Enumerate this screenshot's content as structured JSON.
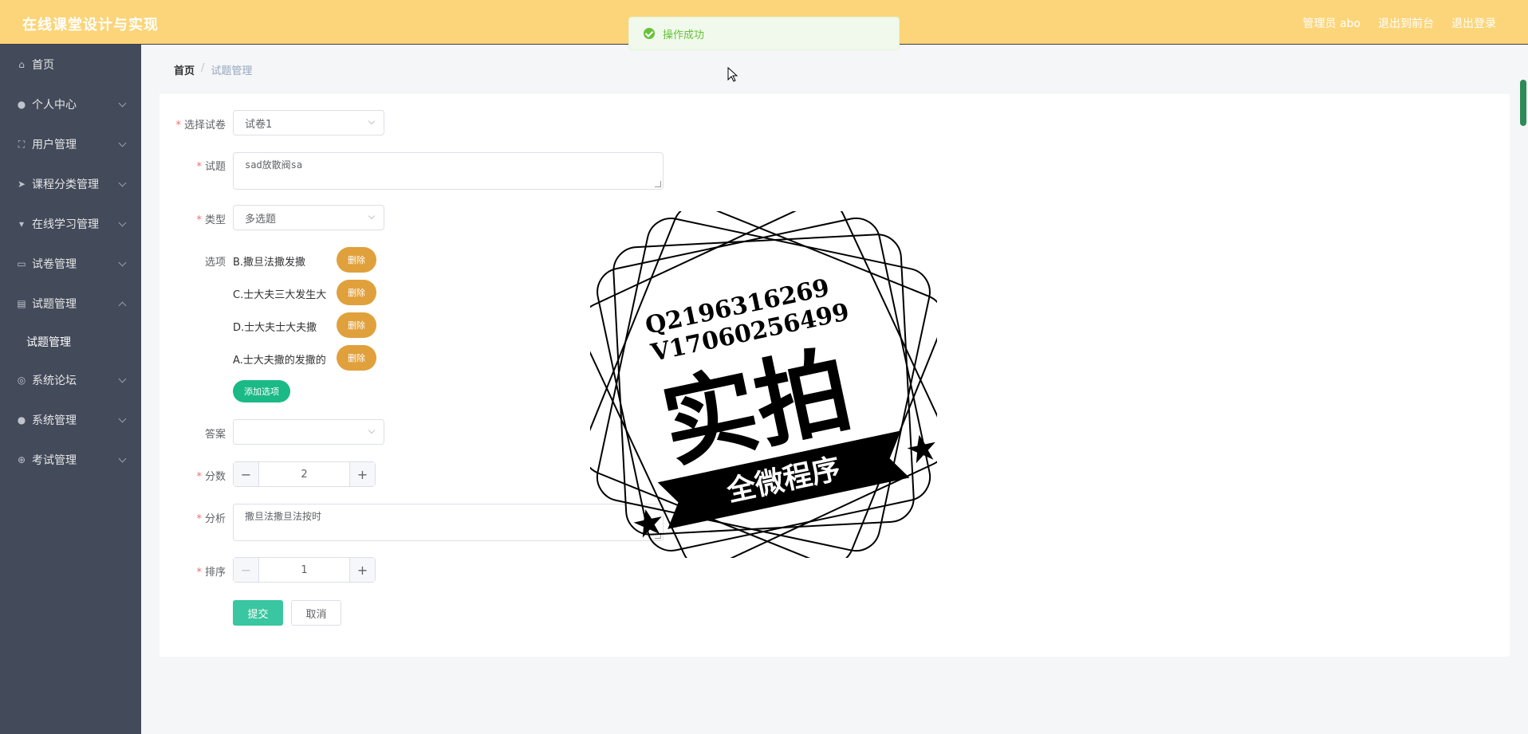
{
  "header": {
    "title": "在线课堂设计与实现",
    "admin": "管理员 abo",
    "to_front": "退出到前台",
    "logout": "退出登录"
  },
  "toast": {
    "message": "操作成功"
  },
  "sidebar": {
    "items": [
      {
        "label": "首页",
        "icon": "home-icon",
        "expandable": false
      },
      {
        "label": "个人中心",
        "icon": "user-icon",
        "expandable": true
      },
      {
        "label": "用户管理",
        "icon": "frame-icon",
        "expandable": true
      },
      {
        "label": "课程分类管理",
        "icon": "send-icon",
        "expandable": true
      },
      {
        "label": "在线学习管理",
        "icon": "pin-icon",
        "expandable": true
      },
      {
        "label": "试卷管理",
        "icon": "chat-icon",
        "expandable": true
      },
      {
        "label": "试题管理",
        "icon": "card-icon",
        "expandable": true,
        "expanded": true
      },
      {
        "label": "系统论坛",
        "icon": "compass-icon",
        "expandable": true
      },
      {
        "label": "系统管理",
        "icon": "user-icon",
        "expandable": true
      },
      {
        "label": "考试管理",
        "icon": "globe-icon",
        "expandable": true
      }
    ],
    "sub_item": "试题管理"
  },
  "breadcrumb": {
    "home": "首页",
    "separator": "/",
    "current": "试题管理"
  },
  "form": {
    "paper": {
      "label": "选择试卷",
      "value": "试卷1"
    },
    "question": {
      "label": "试题",
      "value": "sad放散阀sa"
    },
    "type": {
      "label": "类型",
      "value": "多选题"
    },
    "options": {
      "label": "选项",
      "items": [
        "B.撒旦法撒发撒",
        "C.士大夫三大发生大",
        "D.士大夫士大夫撒",
        "A.士大夫撒的发撒的"
      ],
      "delete_label": "删除",
      "add_label": "添加选项"
    },
    "answer": {
      "label": "答案",
      "value": ""
    },
    "score": {
      "label": "分数",
      "value": "2"
    },
    "analysis": {
      "label": "分析",
      "value": "撒旦法撒旦法按时"
    },
    "order": {
      "label": "排序",
      "value": "1"
    },
    "submit_label": "提交",
    "cancel_label": "取消"
  },
  "watermark": {
    "line1": "Q2196316269",
    "line2": "V17060256499",
    "main": "实拍",
    "banner": "全微程序"
  },
  "colors": {
    "header_bg": "#fcd57a",
    "sidebar_bg": "#434a5a",
    "delete_btn": "#e0a03c",
    "add_btn": "#1bb985",
    "submit_btn": "#39c6a0",
    "required": "#f56c6c",
    "success": "#67c23a"
  }
}
